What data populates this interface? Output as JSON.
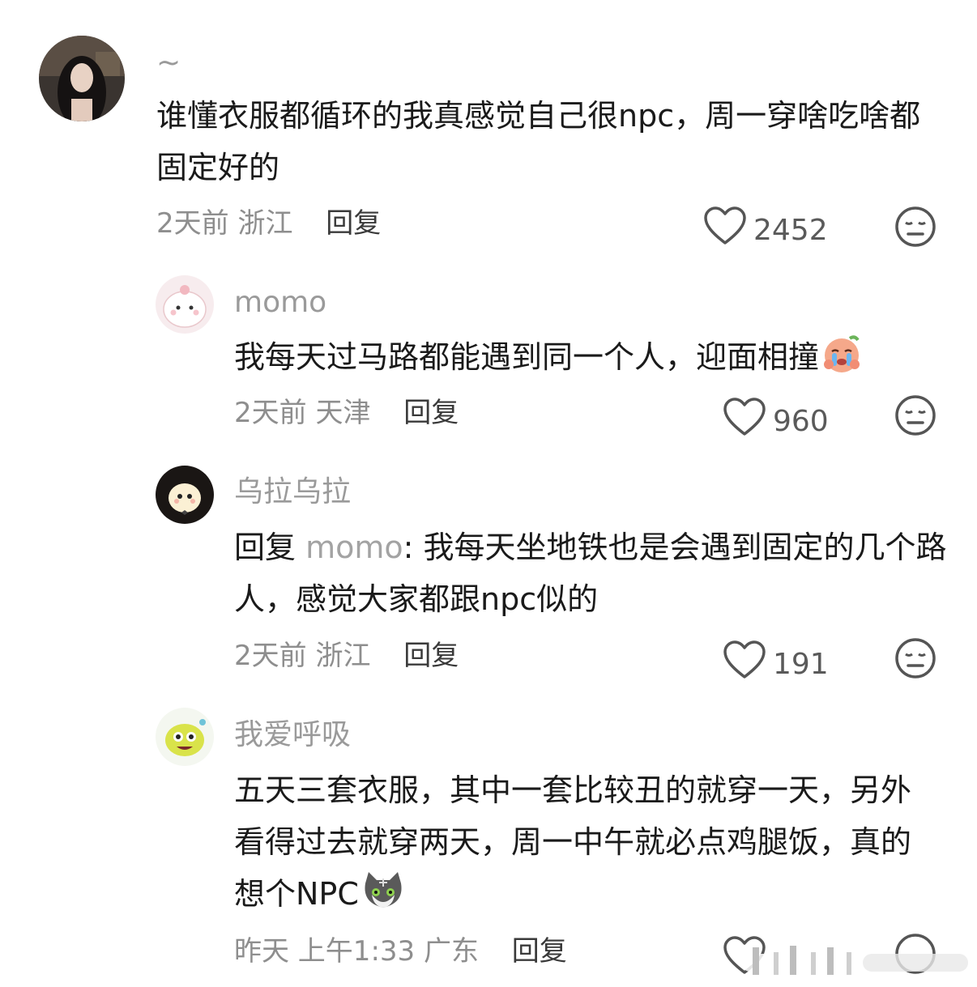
{
  "comments": [
    {
      "name": "~",
      "text": "谁懂衣服都循环的我真感觉自己很npc，周一穿啥吃啥都固定好的",
      "time": "2天前",
      "location": "浙江",
      "reply_label": "回复",
      "likes": "2452"
    },
    {
      "name": "momo",
      "text": "我每天过马路都能遇到同一个人，迎面相撞",
      "emoji": "crying-emoji",
      "time": "2天前",
      "location": "天津",
      "reply_label": "回复",
      "likes": "960"
    },
    {
      "name": "乌拉乌拉",
      "reply_prefix": "回复 ",
      "reply_target": "momo",
      "text": ": 我每天坐地铁也是会遇到固定的几个路人，感觉大家都跟npc似的",
      "time": "2天前",
      "location": "浙江",
      "reply_label": "回复",
      "likes": "191"
    },
    {
      "name": "我爱呼吸",
      "text": "五天三套衣服，其中一套比较丑的就穿一天，另外看得过去就穿两天，周一中午就必点鸡腿饭，真的想个NPC",
      "emoji": "cat-emoji",
      "time": "昨天 上午1:33",
      "location": "广东",
      "reply_label": "回复"
    }
  ],
  "colors": {
    "text": "#1a1a1a",
    "muted": "#8e8e8e",
    "name": "#9a9a9a",
    "icon": "#555555"
  }
}
